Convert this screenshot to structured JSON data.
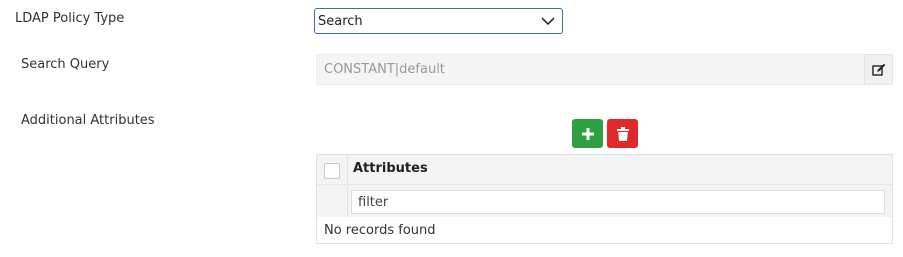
{
  "form": {
    "policy_type": {
      "label": "LDAP Policy Type",
      "value": "Search"
    },
    "search_query": {
      "label": "Search Query",
      "value": "CONSTANT|default"
    },
    "additional_attributes": {
      "label": "Additional Attributes",
      "table": {
        "column": "Attributes",
        "filter_value": "filter",
        "empty_message": "No records found"
      }
    }
  },
  "icons": {
    "dropdown": "chevron-down-icon",
    "edit": "edit-icon",
    "add": "plus-icon",
    "delete": "trash-icon"
  },
  "colors": {
    "select_border": "#3a6ea5",
    "add_button": "#2ea043",
    "delete_button": "#e02a2a"
  }
}
